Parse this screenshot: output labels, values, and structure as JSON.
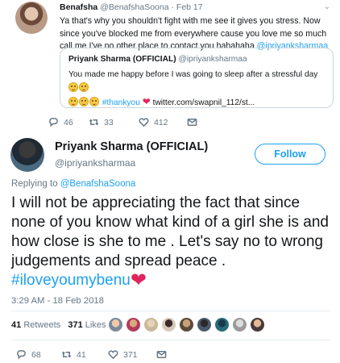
{
  "parent_tweet": {
    "display_name": "Benafsha",
    "handle": "@BenafshaSoona",
    "separator": "·",
    "date": "Feb 17",
    "text": "Ya that's why you shouldn't fight with me see it gives you stress. Now since you've blocked me from everywhere cause you love me so much call me I've no other place to contact you hahahaha ",
    "mention": "@ipriyanksharmaa",
    "quoted": {
      "display_name": "Priyank Sharma (OFFICIAL)",
      "handle": "@ipriyanksharmaa",
      "text_part1": "You made me happy before I was going to sleep after a stressful day",
      "hashtag": "#thankyou",
      "link": "twitter.com/swapnil_112/st..."
    },
    "actions": {
      "reply_count": "46",
      "retweet_count": "33",
      "like_count": "412"
    }
  },
  "main_tweet": {
    "display_name": "Priyank Sharma (OFFICIAL)",
    "handle": "@ipriyanksharmaa",
    "follow_label": "Follow",
    "replying_prefix": "Replying to ",
    "replying_to": "@BenafshaSoona",
    "text": "I will not be appreciating the fact that since none of you know what kind of a girl she is and how close is she to me . Let's say no to wrong judgements and spread peace . ",
    "hashtag": "#iloveyoumybenu",
    "timestamp": "3:29 AM - 18 Feb 2018",
    "retweets_count": "41",
    "retweets_label": "Retweets",
    "likes_count": "371",
    "likes_label": "Likes",
    "actions": {
      "reply_count": "68",
      "retweet_count": "41",
      "like_count": "371"
    }
  },
  "colors": {
    "link": "#1da1f2",
    "heart": "#e0245e",
    "muted": "#657786"
  }
}
